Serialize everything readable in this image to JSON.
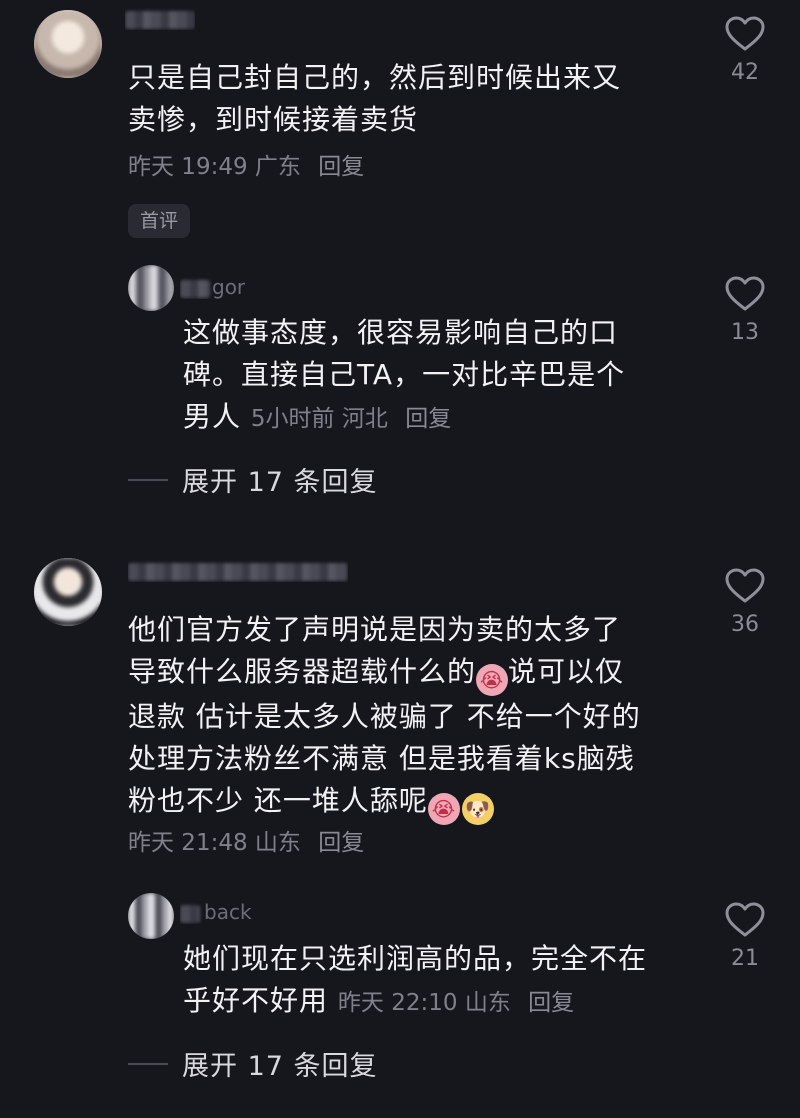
{
  "comments": [
    {
      "text_lines": [
        "只是自己封自己的，然后到时候出来又",
        "卖惨，到时候接着卖货"
      ],
      "time": "昨天 19:49",
      "location": "广东",
      "reply": "回复",
      "badge": "首评",
      "likes": "42"
    },
    {
      "text_lines": [
        "这做事态度，很容易影响自己的口",
        "碑。直接自己TA，一对比辛巴是个",
        "男人"
      ],
      "time": "5小时前",
      "location": "河北",
      "reply": "回复",
      "likes": "13",
      "expand": "展开 17 条回复"
    },
    {
      "text_lines": [
        "他们官方发了声明说是因为卖的太多了",
        "导致什么服务器超载什么的",
        "说可以仅",
        "退款 估计是太多人被骗了 不给一个好的",
        "处理方法粉丝不满意 但是我看着ks脑残",
        "粉也不少 还一堆人舔呢"
      ],
      "time": "昨天 21:48",
      "location": "山东",
      "reply": "回复",
      "likes": "36"
    },
    {
      "text_lines": [
        "她们现在只选利润高的品，完全不在",
        "乎好不好用"
      ],
      "time": "昨天 22:10",
      "location": "山东",
      "reply": "回复",
      "likes": "21",
      "expand": "展开 17 条回复"
    }
  ],
  "usernames": {
    "c2": "gor",
    "c4": "back"
  },
  "icons": {
    "like": "heart-outline-icon",
    "emoji_cry": "crying-face-emoji-icon",
    "emoji_dog": "dog-face-emoji-icon"
  },
  "colors": {
    "background": "#16161d",
    "text": "#f2f2f4",
    "meta": "#80808b"
  }
}
